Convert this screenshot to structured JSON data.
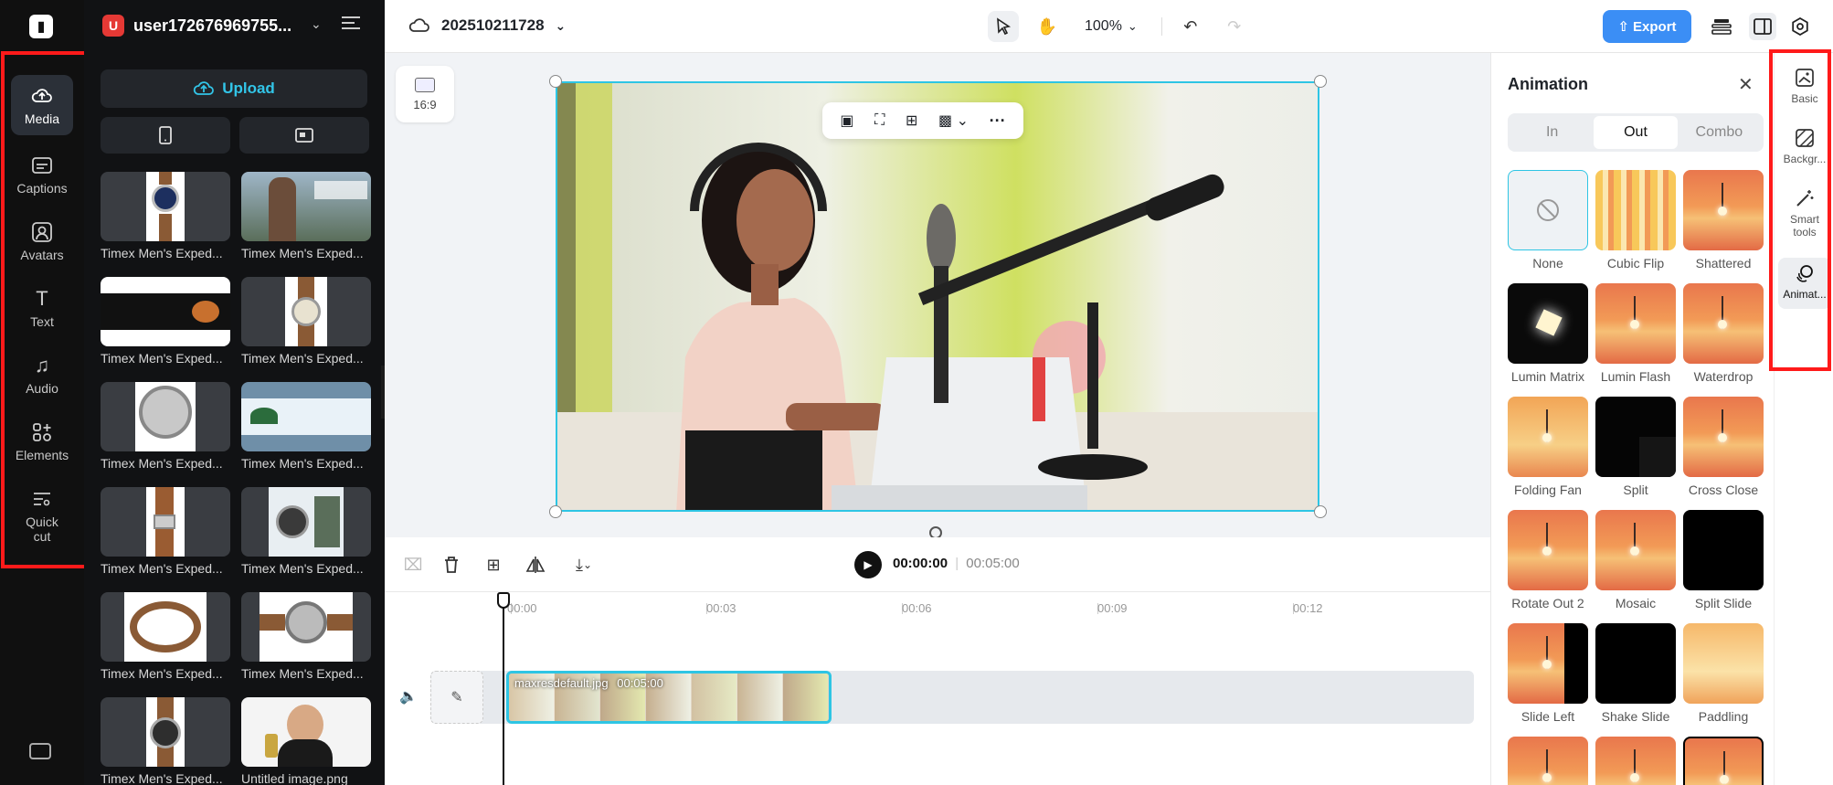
{
  "rail": {
    "items": [
      {
        "label": "Media",
        "icon": "cloud-upload-icon"
      },
      {
        "label": "Captions",
        "icon": "captions-icon"
      },
      {
        "label": "Avatars",
        "icon": "avatar-icon"
      },
      {
        "label": "Text",
        "icon": "text-icon"
      },
      {
        "label": "Audio",
        "icon": "music-icon"
      },
      {
        "label": "Elements",
        "icon": "elements-icon"
      },
      {
        "label": "Quick cut",
        "icon": "quick-cut-icon"
      }
    ]
  },
  "media": {
    "username": "user172676969755...",
    "avatar_letter": "U",
    "upload_label": "Upload",
    "items": [
      {
        "caption": "Timex Men's Exped..."
      },
      {
        "caption": "Timex Men's Exped..."
      },
      {
        "caption": "Timex Men's Exped..."
      },
      {
        "caption": "Timex Men's Exped..."
      },
      {
        "caption": "Timex Men's Exped..."
      },
      {
        "caption": "Timex Men's Exped..."
      },
      {
        "caption": "Timex Men's Exped..."
      },
      {
        "caption": "Timex Men's Exped..."
      },
      {
        "caption": "Timex Men's Exped..."
      },
      {
        "caption": "Timex Men's Exped..."
      },
      {
        "caption": "Timex Men's Exped..."
      },
      {
        "caption": "Untitled image.png"
      }
    ]
  },
  "topbar": {
    "project_name": "202510211728",
    "zoom": "100%",
    "export_label": "Export"
  },
  "canvas": {
    "aspect_ratio": "16:9"
  },
  "playback": {
    "current_time": "00:00:00",
    "separator": "|",
    "total_time": "00:05:00",
    "zoom_level": 0.2
  },
  "timeline": {
    "ticks": [
      "00:00",
      "00:03",
      "00:06",
      "00:09",
      "00:12"
    ],
    "clip_name": "maxresdefault.jpg",
    "clip_duration": "00:05:00"
  },
  "animation": {
    "title": "Animation",
    "tabs": [
      "In",
      "Out",
      "Combo"
    ],
    "active_tab": "Out",
    "presets": [
      {
        "name": "None"
      },
      {
        "name": "Cubic Flip"
      },
      {
        "name": "Shattered"
      },
      {
        "name": "Lumin Matrix"
      },
      {
        "name": "Lumin Flash"
      },
      {
        "name": "Waterdrop"
      },
      {
        "name": "Folding Fan"
      },
      {
        "name": "Split"
      },
      {
        "name": "Cross Close"
      },
      {
        "name": "Rotate Out 2"
      },
      {
        "name": "Mosaic"
      },
      {
        "name": "Split Slide"
      },
      {
        "name": "Slide Left"
      },
      {
        "name": "Shake Slide"
      },
      {
        "name": "Paddling"
      }
    ]
  },
  "siderail": {
    "items": [
      {
        "label": "Basic",
        "icon": "image-icon"
      },
      {
        "label": "Backgr...",
        "icon": "background-icon"
      },
      {
        "label": "Smart tools",
        "icon": "magic-wand-icon"
      },
      {
        "label": "Animat...",
        "icon": "animation-icon"
      }
    ]
  },
  "colors": {
    "accent": "#2ec5e4",
    "export": "#3b8ef5",
    "highlight_box": "#ff1a1a"
  }
}
